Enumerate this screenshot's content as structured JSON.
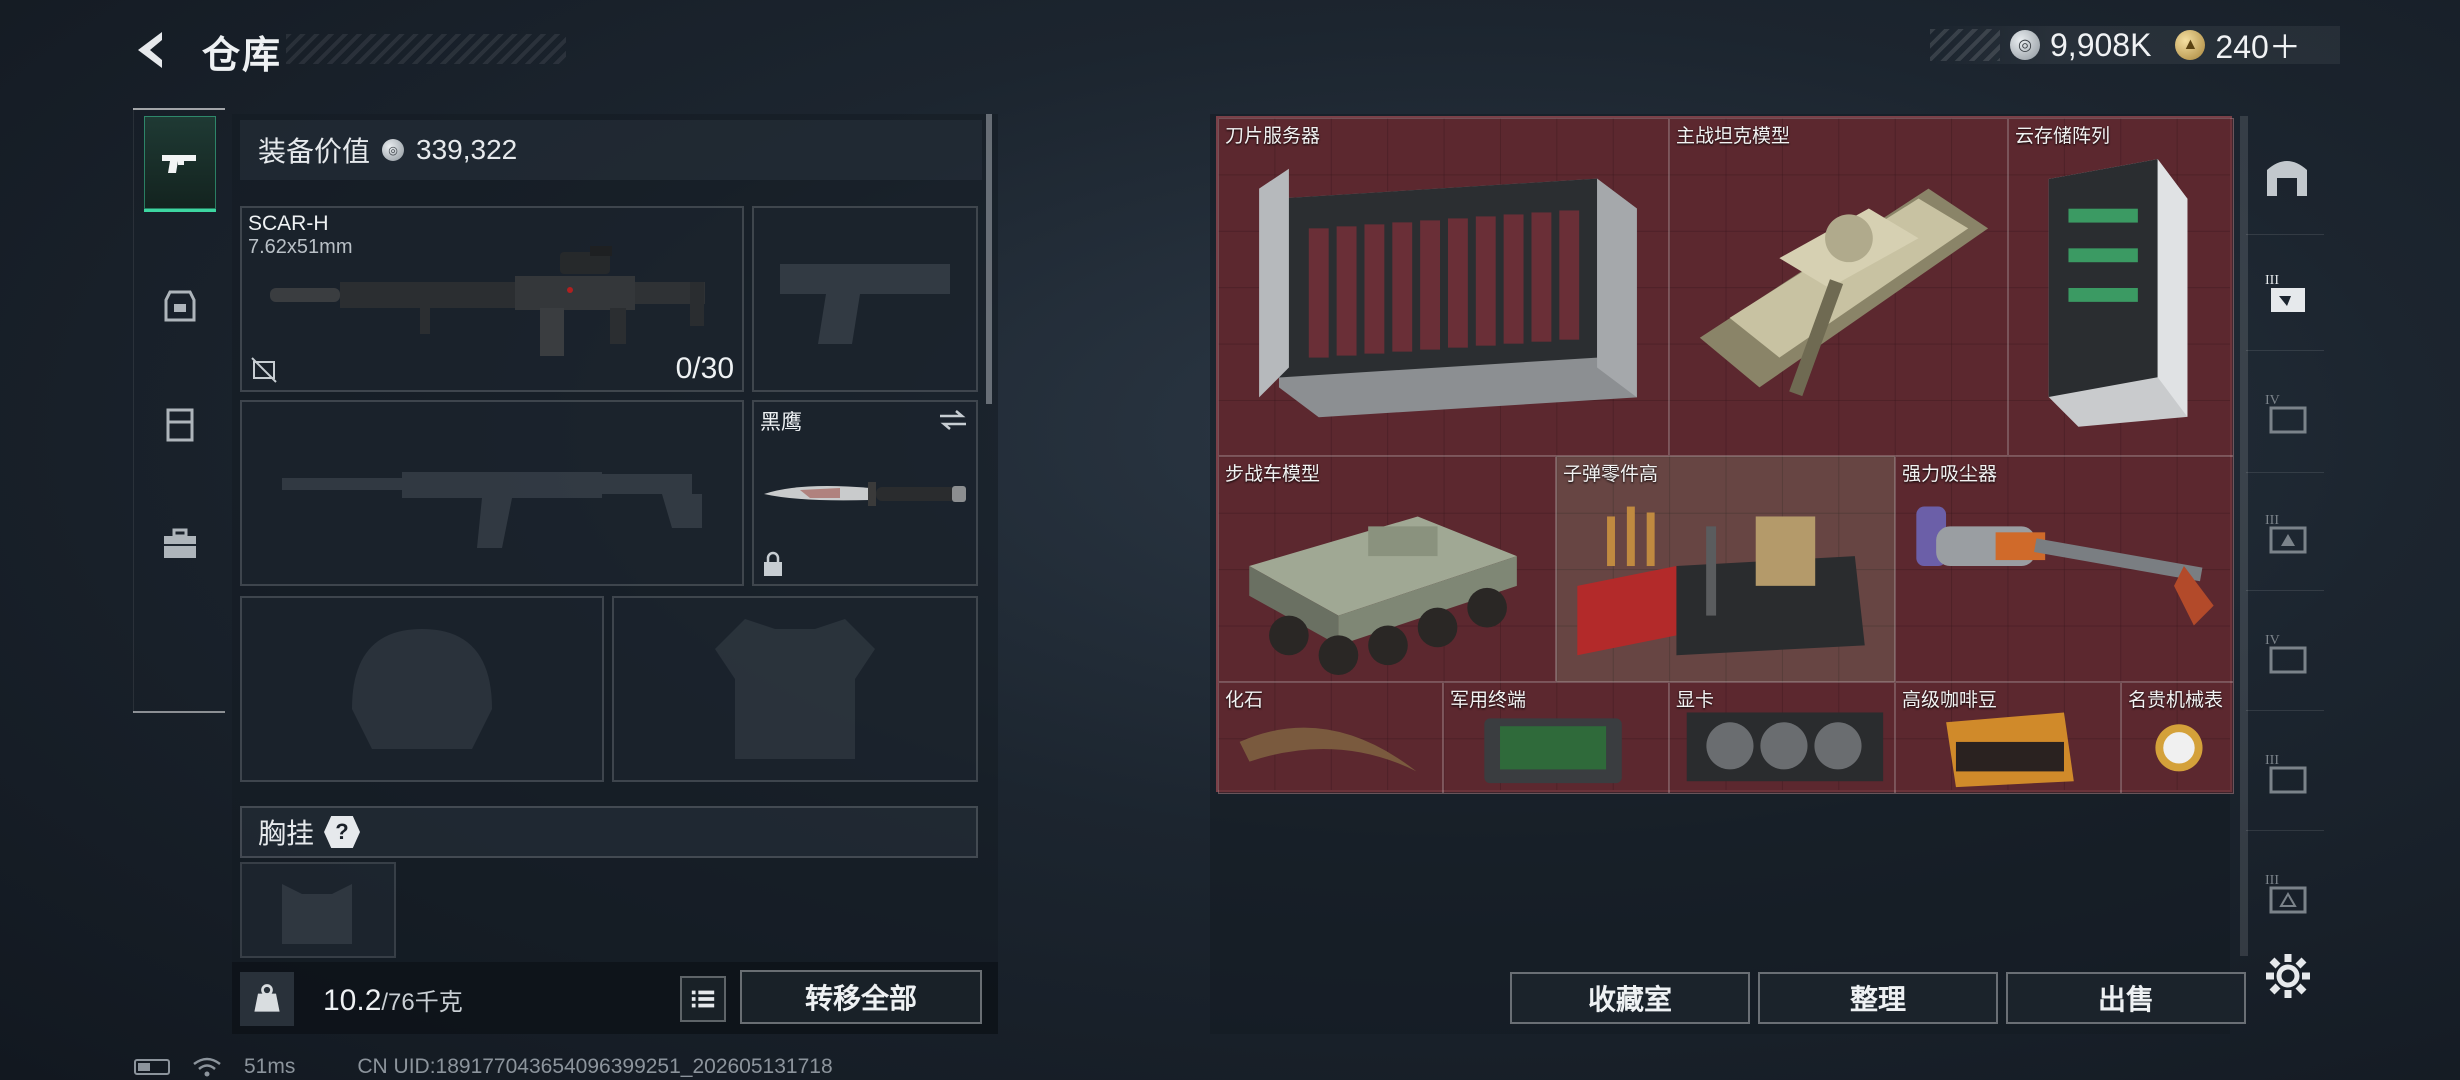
{
  "header": {
    "title": "仓库",
    "currency": [
      {
        "icon": "silver-coin-icon",
        "value": "9,908K"
      },
      {
        "icon": "gold-coin-icon",
        "value": "240＋"
      }
    ]
  },
  "left_nav": {
    "items": [
      {
        "icon": "pistol-icon",
        "active": true
      },
      {
        "icon": "backpack-icon",
        "active": false
      },
      {
        "icon": "chest-rig-icon",
        "active": false
      },
      {
        "icon": "briefcase-icon",
        "active": false
      }
    ]
  },
  "loadout": {
    "equipment_value_label": "装备价值",
    "equipment_value": "339,322",
    "primary": {
      "name": "SCAR-H",
      "caliber": "7.62x51mm",
      "ammo": "0/30"
    },
    "melee": {
      "name": "黑鹰"
    },
    "chest_rig_label": "胸挂",
    "chest_help": "?"
  },
  "weight": {
    "current": "10.2",
    "max": "/76千克"
  },
  "actions": {
    "transfer_all": "转移全部",
    "collection": "收藏室",
    "organize": "整理",
    "sell": "出售"
  },
  "storage": {
    "items": [
      {
        "name": "刀片服务器"
      },
      {
        "name": "主战坦克模型"
      },
      {
        "name": "云存储阵列"
      },
      {
        "name": "步战车模型"
      },
      {
        "name": "子弹零件高"
      },
      {
        "name": "强力吸尘器"
      },
      {
        "name": "化石"
      },
      {
        "name": "军用终端"
      },
      {
        "name": "显卡"
      },
      {
        "name": "高级咖啡豆"
      },
      {
        "name": "名贵机械表"
      }
    ]
  },
  "right_nav": {
    "items": [
      {
        "icon": "vault-icon"
      },
      {
        "icon": "storage-tier-3-icon"
      },
      {
        "icon": "storage-tier-4-icon"
      },
      {
        "icon": "storage-tier-3b-icon"
      },
      {
        "icon": "storage-tier-4b-icon"
      },
      {
        "icon": "storage-tier-3c-icon"
      },
      {
        "icon": "storage-tier-3d-icon"
      }
    ]
  },
  "footer": {
    "ping": "51ms",
    "uid": "CN UID:189177043654096399251_202605131718"
  },
  "colors": {
    "accent": "#3dd6a1",
    "storage_bg": "#5a2830"
  }
}
